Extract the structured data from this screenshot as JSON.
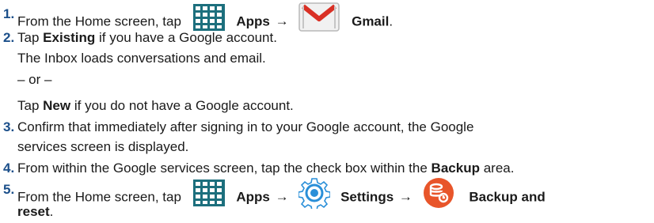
{
  "steps": [
    {
      "number": "1.",
      "pre": "From the Home screen, tap",
      "apps": "Apps",
      "arrow": "→",
      "gmail": "Gmail",
      "end": "."
    },
    {
      "number": "2.",
      "pre": "Tap",
      "bold": "Existing",
      "post": "if you have a Google account.",
      "sub1": "The Inbox loads conversations and email.",
      "or": "– or –",
      "sub2_pre": "Tap",
      "sub2_bold": "New",
      "sub2_post": "if you do not have a Google account."
    },
    {
      "number": "3.",
      "line1": "Confirm that immediately after signing in to your Google account, the Google",
      "line2": "services screen is displayed."
    },
    {
      "number": "4.",
      "pre": "From within the Google services screen, tap the check box within the",
      "bold": "Backup",
      "post": "area."
    },
    {
      "number": "5.",
      "pre": "From the Home screen, tap",
      "apps": "Apps",
      "arrow1": "→",
      "settings": "Settings",
      "arrow2": "→",
      "backup": "Backup and",
      "reset": "reset",
      "end": "."
    }
  ],
  "icons": {
    "apps": "apps-grid-icon",
    "gmail": "gmail-envelope-icon",
    "settings": "settings-gear-icon",
    "backup": "backup-reset-icon"
  },
  "colors": {
    "step_number": "#1b4f8a",
    "apps_grid": "#1c6f7d",
    "gmail_red": "#d93025",
    "settings_blue": "#2a8fd8",
    "backup_orange": "#e8552a"
  }
}
